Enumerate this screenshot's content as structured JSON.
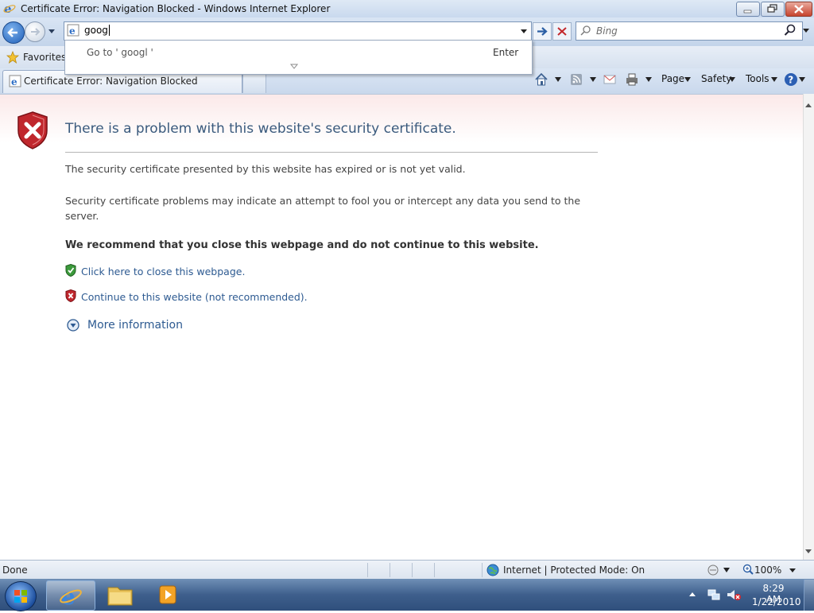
{
  "window": {
    "title": "Certificate Error: Navigation Blocked - Windows Internet Explorer"
  },
  "address": {
    "value": "googl",
    "autocomplete_go": "Go to ' googl '",
    "autocomplete_enter": "Enter"
  },
  "search": {
    "placeholder": "Bing"
  },
  "favorites": {
    "label": "Favorites"
  },
  "tab": {
    "label": "Certificate Error: Navigation Blocked"
  },
  "commandbar": {
    "page": "Page",
    "safety": "Safety",
    "tools": "Tools"
  },
  "page": {
    "heading": "There is a problem with this website's security certificate.",
    "para1": "The security certificate presented by this website has expired or is not yet valid.",
    "para2": "Security certificate problems may indicate an attempt to fool you or intercept any data you send to the server.",
    "recommend": "We recommend that you close this webpage and do not continue to this website.",
    "close_link": "Click here to close this webpage.",
    "continue_link": "Continue to this website (not recommended).",
    "more_info": "More information"
  },
  "status": {
    "text": "Done",
    "zone": "Internet | Protected Mode: On",
    "zoom": "100%"
  },
  "taskbar": {
    "time": "8:29 AM",
    "date": "1/22/2010"
  },
  "colors": {
    "link": "#2d5a91",
    "heading": "#3a5a7d",
    "error_red": "#c0272d",
    "safe_green": "#3c9a3c"
  },
  "icons": [
    "ie-icon",
    "back-arrow-icon",
    "forward-arrow-icon",
    "search-icon",
    "star-icon",
    "home-icon",
    "rss-icon",
    "mail-icon",
    "print-icon",
    "help-icon",
    "shield-error-icon",
    "shield-ok-icon",
    "expand-icon",
    "globe-icon",
    "zoom-icon",
    "windows-logo-icon",
    "folder-icon",
    "media-player-icon",
    "network-icon",
    "volume-muted-icon"
  ]
}
